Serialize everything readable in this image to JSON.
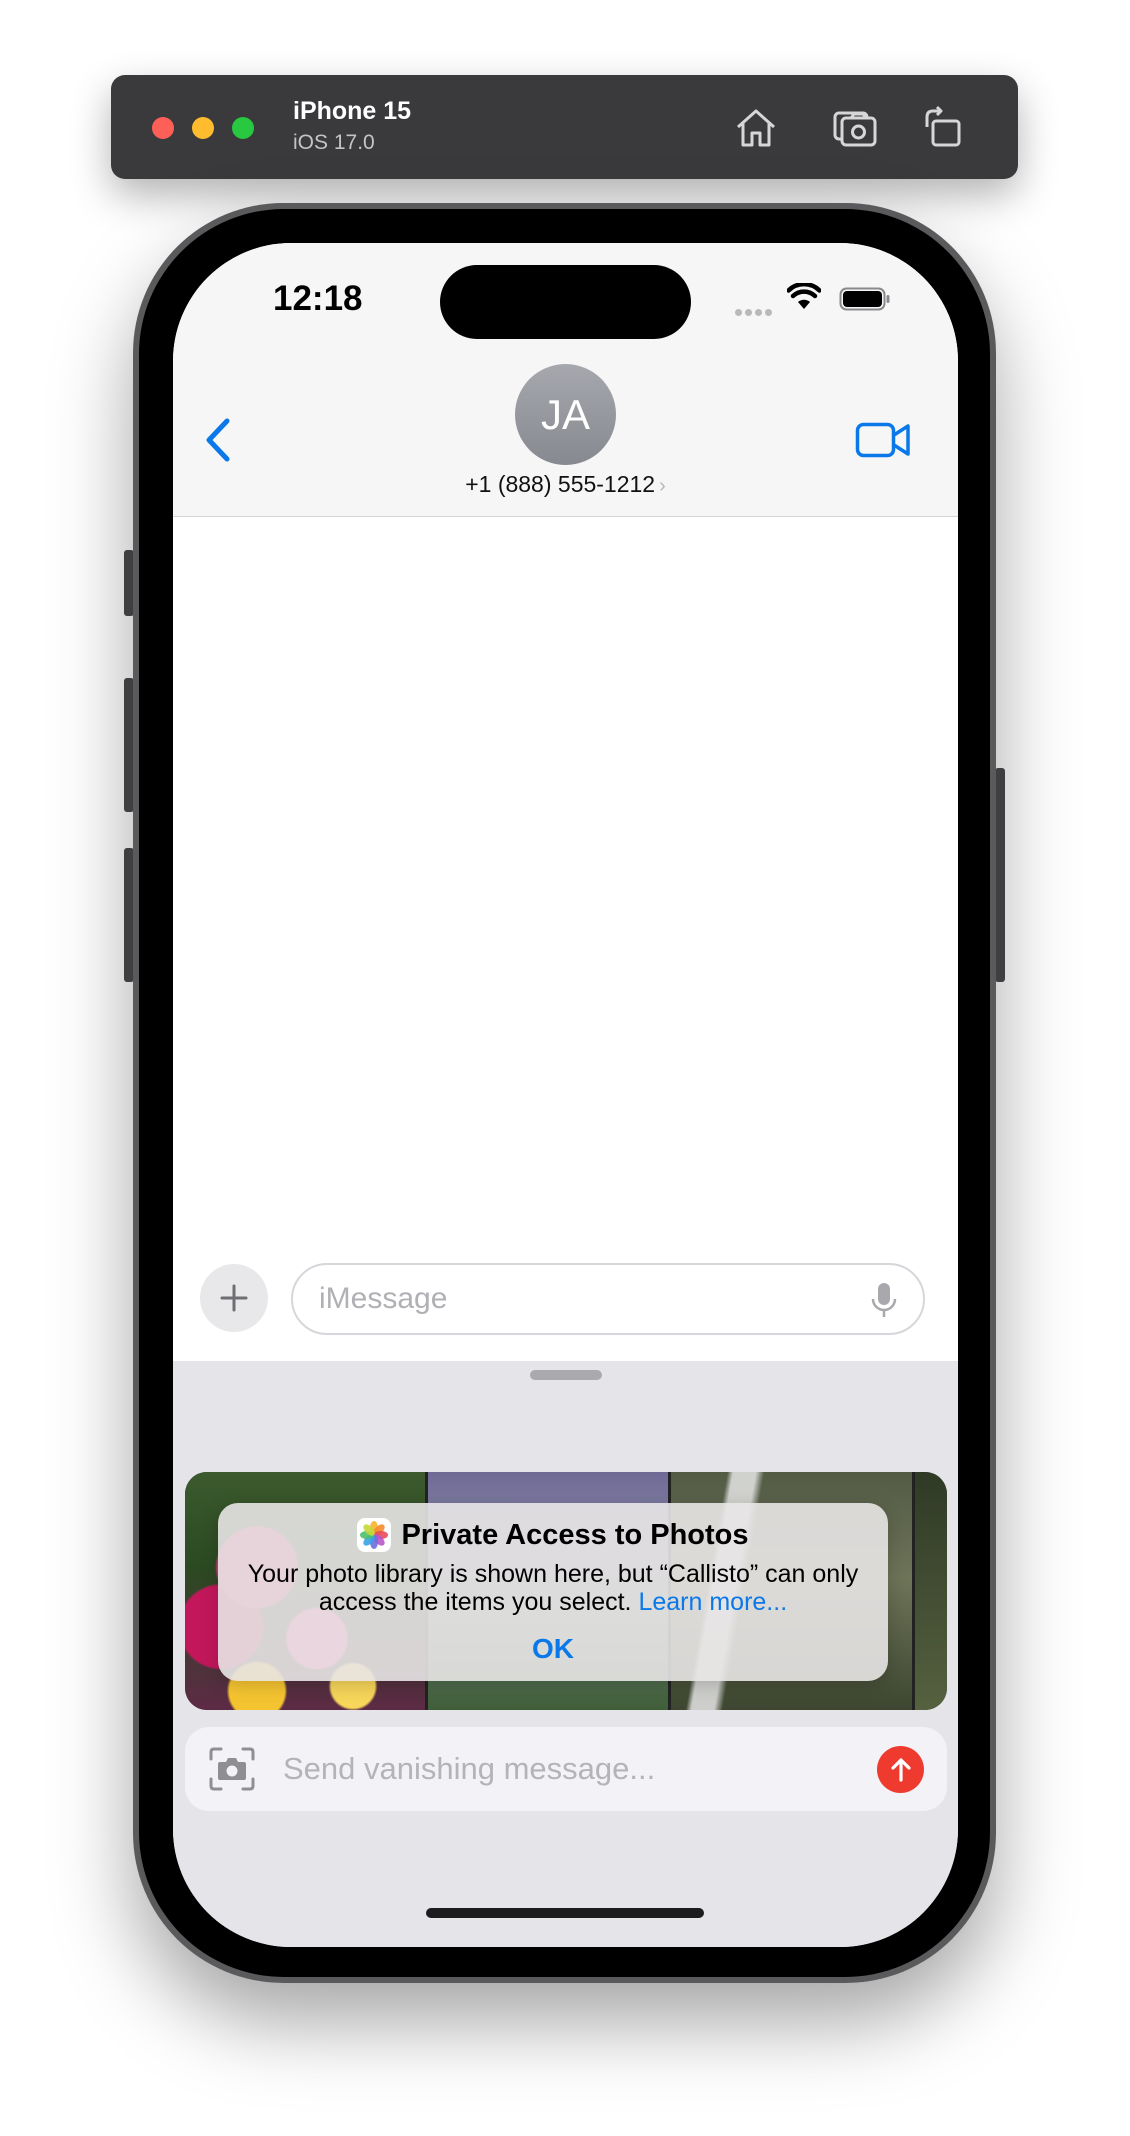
{
  "simulator": {
    "device_name": "iPhone 15",
    "os_version": "iOS 17.0",
    "toolbar_icons": [
      "home-icon",
      "screenshot-icon",
      "rotate-icon"
    ]
  },
  "status_bar": {
    "time": "12:18",
    "icons": [
      "signal-dots",
      "wifi-icon",
      "battery-icon"
    ]
  },
  "conversation_header": {
    "back_icon": "chevron-left-icon",
    "avatar_initials": "JA",
    "contact_phone": "+1 (888) 555-1212",
    "contact_chevron": "›",
    "video_icon": "video-camera-icon"
  },
  "composer": {
    "plus_icon": "plus-icon",
    "placeholder": "iMessage",
    "mic_icon": "microphone-icon"
  },
  "photo_picker": {
    "alert": {
      "title": "Private Access to Photos",
      "body": "Your photo library is shown here, but “Callisto” can only access the items you select.",
      "link": "Learn more...",
      "ok_label": "OK"
    },
    "vanish_placeholder": "Send vanishing message...",
    "camera_icon": "camera-icon",
    "send_icon": "arrow-up-icon"
  },
  "colors": {
    "accent_blue": "#0a78e8",
    "send_red": "#ef3b2f",
    "toolbar_bg": "#3a3a3c",
    "sheet_bg": "#e4e4e9"
  }
}
